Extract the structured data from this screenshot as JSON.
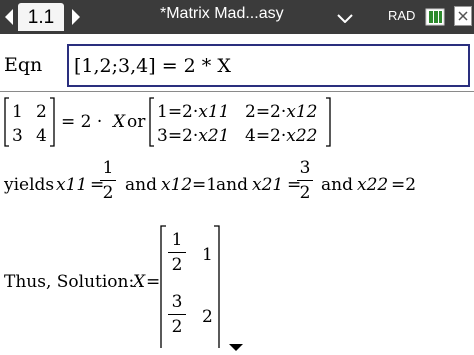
{
  "topbar": {
    "tab_label": "1.1",
    "doc_title": "*Matrix Mad...asy",
    "angle_mode": "RAD",
    "icons": [
      "nav-left-icon",
      "nav-right-icon",
      "chevron-down-icon",
      "battery-icon",
      "close-icon"
    ]
  },
  "equation": {
    "label": "Eqn",
    "value": "[1,2;3,4] = 2 * X"
  },
  "matrix_line": {
    "a11": "1",
    "a12": "2",
    "a21": "3",
    "a22": "4",
    "eq_text": "= 2 ·",
    "x": "X",
    "or": "or",
    "r1c1": "1=2·",
    "r1c1_var": "x11",
    "r1c2": "2=2·",
    "r1c2_var": "x12",
    "r2c1": "3=2·",
    "r2c1_var": "x21",
    "r2c2": "4=2·",
    "r2c2_var": "x22"
  },
  "yields_line": {
    "yields": "yields",
    "x11": "x11",
    "eq1": "=",
    "frac1_num": "1",
    "frac1_den": "2",
    "and1": "and",
    "x12": "x12",
    "eq2": "=1",
    "and2": "and",
    "x21": "x21",
    "eq3": "=",
    "frac3_num": "3",
    "frac3_den": "2",
    "and3": "and",
    "x22": "x22",
    "eq4": "=2"
  },
  "solution": {
    "prefix": "Thus, Solution:",
    "x": "X",
    "eq": "=",
    "m11_num": "1",
    "m11_den": "2",
    "m12": "1",
    "m21_num": "3",
    "m21_den": "2",
    "m22": "2"
  }
}
